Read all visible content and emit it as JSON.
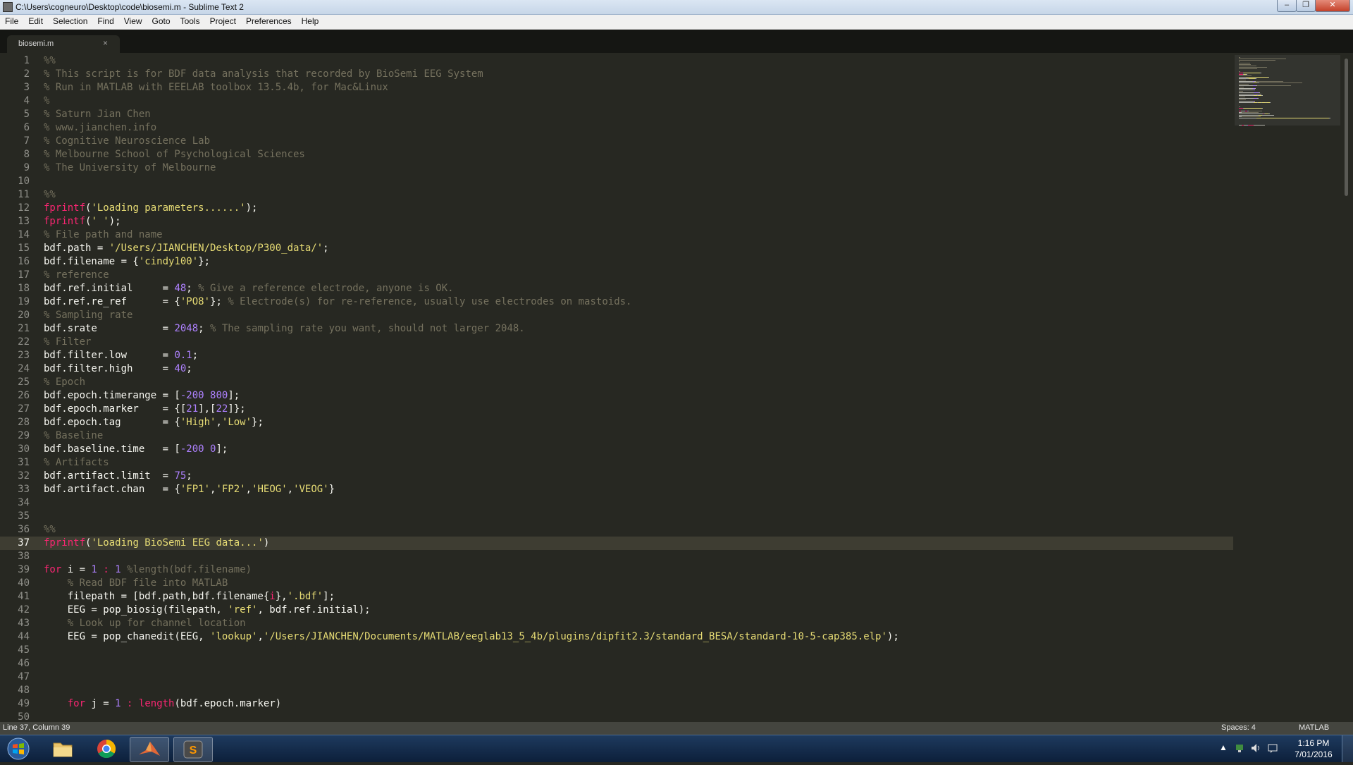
{
  "window": {
    "title": "C:\\Users\\cogneuro\\Desktop\\code\\biosemi.m - Sublime Text 2",
    "minimize_glyph": "‒",
    "maximize_glyph": "❐",
    "close_glyph": "✕"
  },
  "menu": [
    "File",
    "Edit",
    "Selection",
    "Find",
    "View",
    "Goto",
    "Tools",
    "Project",
    "Preferences",
    "Help"
  ],
  "tab": {
    "label": "biosemi.m",
    "close_glyph": "×"
  },
  "editor": {
    "active_line": 37,
    "line_numbers": [
      "1",
      "2",
      "3",
      "4",
      "5",
      "6",
      "7",
      "8",
      "9",
      "10",
      "11",
      "12",
      "13",
      "14",
      "15",
      "16",
      "17",
      "18",
      "19",
      "20",
      "21",
      "22",
      "23",
      "24",
      "25",
      "26",
      "27",
      "28",
      "29",
      "30",
      "31",
      "32",
      "33",
      "34",
      "35",
      "36",
      "37",
      "38",
      "39",
      "40",
      "41",
      "42",
      "43",
      "44",
      "45",
      "46",
      "47",
      "48",
      "49",
      "50"
    ],
    "lines": [
      [
        [
          "c",
          "%%"
        ]
      ],
      [
        [
          "c",
          "% This script is for BDF data analysis that recorded by BioSemi EEG System"
        ]
      ],
      [
        [
          "c",
          "% Run in MATLAB with EEELAB toolbox 13.5.4b, for Mac&Linux"
        ]
      ],
      [
        [
          "c",
          "%"
        ]
      ],
      [
        [
          "c",
          "% Saturn Jian Chen"
        ]
      ],
      [
        [
          "c",
          "% www.jianchen.info"
        ]
      ],
      [
        [
          "c",
          "% Cognitive Neuroscience Lab"
        ]
      ],
      [
        [
          "c",
          "% Melbourne School of Psychological Sciences"
        ]
      ],
      [
        [
          "c",
          "% The University of Melbourne"
        ]
      ],
      [],
      [
        [
          "c",
          "%%"
        ]
      ],
      [
        [
          "f",
          "fprintf"
        ],
        [
          "p",
          "("
        ],
        [
          "s",
          "'Loading parameters......'"
        ],
        [
          "p",
          ");"
        ]
      ],
      [
        [
          "f",
          "fprintf"
        ],
        [
          "p",
          "("
        ],
        [
          "s",
          "' '"
        ],
        [
          "p",
          ");"
        ]
      ],
      [
        [
          "c",
          "% File path and name"
        ]
      ],
      [
        [
          "p",
          "bdf.path = "
        ],
        [
          "s",
          "'/Users/JIANCHEN/Desktop/P300_data/'"
        ],
        [
          "p",
          ";"
        ]
      ],
      [
        [
          "p",
          "bdf.filename = {"
        ],
        [
          "s",
          "'cindy100'"
        ],
        [
          "p",
          "};"
        ]
      ],
      [
        [
          "c",
          "% reference"
        ]
      ],
      [
        [
          "p",
          "bdf.ref.initial     = "
        ],
        [
          "n",
          "48"
        ],
        [
          "p",
          "; "
        ],
        [
          "c",
          "% Give a reference electrode, anyone is OK."
        ]
      ],
      [
        [
          "p",
          "bdf.ref.re_ref      = {"
        ],
        [
          "s",
          "'PO8'"
        ],
        [
          "p",
          "}; "
        ],
        [
          "c",
          "% Electrode(s) for re-reference, usually use electrodes on mastoids."
        ]
      ],
      [
        [
          "c",
          "% Sampling rate"
        ]
      ],
      [
        [
          "p",
          "bdf.srate           = "
        ],
        [
          "n",
          "2048"
        ],
        [
          "p",
          "; "
        ],
        [
          "c",
          "% The sampling rate you want, should not larger 2048."
        ]
      ],
      [
        [
          "c",
          "% Filter"
        ]
      ],
      [
        [
          "p",
          "bdf.filter.low      = "
        ],
        [
          "n",
          "0.1"
        ],
        [
          "p",
          ";"
        ]
      ],
      [
        [
          "p",
          "bdf.filter.high     = "
        ],
        [
          "n",
          "40"
        ],
        [
          "p",
          ";"
        ]
      ],
      [
        [
          "c",
          "% Epoch"
        ]
      ],
      [
        [
          "p",
          "bdf.epoch.timerange = ["
        ],
        [
          "n",
          "-200 800"
        ],
        [
          "p",
          "];"
        ]
      ],
      [
        [
          "p",
          "bdf.epoch.marker    = {["
        ],
        [
          "n",
          "21"
        ],
        [
          "p",
          "],["
        ],
        [
          "n",
          "22"
        ],
        [
          "p",
          "]};"
        ]
      ],
      [
        [
          "p",
          "bdf.epoch.tag       = {"
        ],
        [
          "s",
          "'High'"
        ],
        [
          "p",
          ","
        ],
        [
          "s",
          "'Low'"
        ],
        [
          "p",
          "};"
        ]
      ],
      [
        [
          "c",
          "% Baseline"
        ]
      ],
      [
        [
          "p",
          "bdf.baseline.time   = ["
        ],
        [
          "n",
          "-200 0"
        ],
        [
          "p",
          "];"
        ]
      ],
      [
        [
          "c",
          "% Artifacts"
        ]
      ],
      [
        [
          "p",
          "bdf.artifact.limit  = "
        ],
        [
          "n",
          "75"
        ],
        [
          "p",
          ";"
        ]
      ],
      [
        [
          "p",
          "bdf.artifact.chan   = {"
        ],
        [
          "s",
          "'FP1'"
        ],
        [
          "p",
          ","
        ],
        [
          "s",
          "'FP2'"
        ],
        [
          "p",
          ","
        ],
        [
          "s",
          "'HEOG'"
        ],
        [
          "p",
          ","
        ],
        [
          "s",
          "'VEOG'"
        ],
        [
          "p",
          "}"
        ]
      ],
      [],
      [],
      [
        [
          "c",
          "%%"
        ]
      ],
      [
        [
          "f",
          "fprintf"
        ],
        [
          "p",
          "("
        ],
        [
          "s",
          "'Loading BioSemi EEG data...'"
        ],
        [
          "p",
          ")"
        ]
      ],
      [],
      [
        [
          "f",
          "for"
        ],
        [
          "p",
          " i = "
        ],
        [
          "n",
          "1"
        ],
        [
          "f",
          " : "
        ],
        [
          "n",
          "1"
        ],
        [
          "p",
          " "
        ],
        [
          "c",
          "%length(bdf.filename)"
        ]
      ],
      [
        [
          "p",
          "    "
        ],
        [
          "c",
          "% Read BDF file into MATLAB"
        ]
      ],
      [
        [
          "p",
          "    filepath = [bdf.path,bdf.filename{"
        ],
        [
          "f",
          "i"
        ],
        [
          "p",
          "},"
        ],
        [
          "s",
          "'.bdf'"
        ],
        [
          "p",
          "];"
        ]
      ],
      [
        [
          "p",
          "    EEG = pop_biosig(filepath, "
        ],
        [
          "s",
          "'ref'"
        ],
        [
          "p",
          ", bdf.ref.initial);"
        ]
      ],
      [
        [
          "p",
          "    "
        ],
        [
          "c",
          "% Look up for channel location"
        ]
      ],
      [
        [
          "p",
          "    EEG = pop_chanedit(EEG, "
        ],
        [
          "s",
          "'lookup'"
        ],
        [
          "p",
          ","
        ],
        [
          "s",
          "'/Users/JIANCHEN/Documents/MATLAB/eeglab13_5_4b/plugins/dipfit2.3/standard_BESA/standard-10-5-cap385.elp'"
        ],
        [
          "p",
          ");"
        ]
      ],
      [],
      [],
      [],
      [],
      [
        [
          "p",
          "    "
        ],
        [
          "f",
          "for"
        ],
        [
          "p",
          " j = "
        ],
        [
          "n",
          "1"
        ],
        [
          "f",
          " : "
        ],
        [
          "f",
          "length"
        ],
        [
          "p",
          "(bdf.epoch.marker)"
        ]
      ],
      []
    ]
  },
  "status": {
    "position": "Line 37, Column 39",
    "indent": "Spaces: 4",
    "syntax": "MATLAB"
  },
  "taskbar": {
    "apps": [
      "windows-start-icon",
      "file-explorer-icon",
      "chrome-icon",
      "matlab-icon",
      "sublime-text-icon"
    ],
    "tray_up_glyph": "▲",
    "time": "1:16 PM",
    "date": "7/01/2016"
  },
  "colors": {
    "background": "#272822",
    "comment": "#75715e",
    "keyword": "#f92672",
    "string": "#e6db74",
    "number": "#ae81ff",
    "text": "#f8f8f2"
  }
}
